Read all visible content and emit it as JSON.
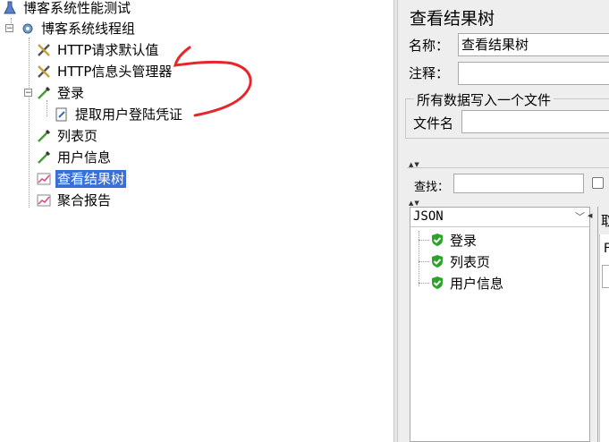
{
  "tree": {
    "root": "博客系统性能测试",
    "thread_group": "博客系统线程组",
    "items": [
      {
        "label": "HTTP请求默认值",
        "icon": "wrench-icon"
      },
      {
        "label": "HTTP信息头管理器",
        "icon": "wrench-icon"
      },
      {
        "label": "登录",
        "icon": "pipette-icon"
      },
      {
        "label": "提取用户登陆凭证",
        "icon": "extractor-icon"
      },
      {
        "label": "列表页",
        "icon": "pipette-icon"
      },
      {
        "label": "用户信息",
        "icon": "pipette-icon"
      },
      {
        "label": "查看结果树",
        "icon": "chart-icon"
      },
      {
        "label": "聚合报告",
        "icon": "chart-icon"
      }
    ]
  },
  "panel": {
    "title": "查看结果树",
    "name_label": "名称：",
    "name_value": "查看结果树",
    "comment_label": "注释：",
    "comment_value": "",
    "group_title": "所有数据写入一个文件",
    "filename_label": "文件名",
    "filename_value": "",
    "search_label": "查找：",
    "search_value": "",
    "renderer": "JSON",
    "results": [
      "登录",
      "列表页",
      "用户信息"
    ],
    "tab_label": "取",
    "tab_inner_label": "F"
  },
  "colors": {
    "selection": "#3a6fd8",
    "annotation": "#e8262a",
    "success": "#2aa52a"
  }
}
